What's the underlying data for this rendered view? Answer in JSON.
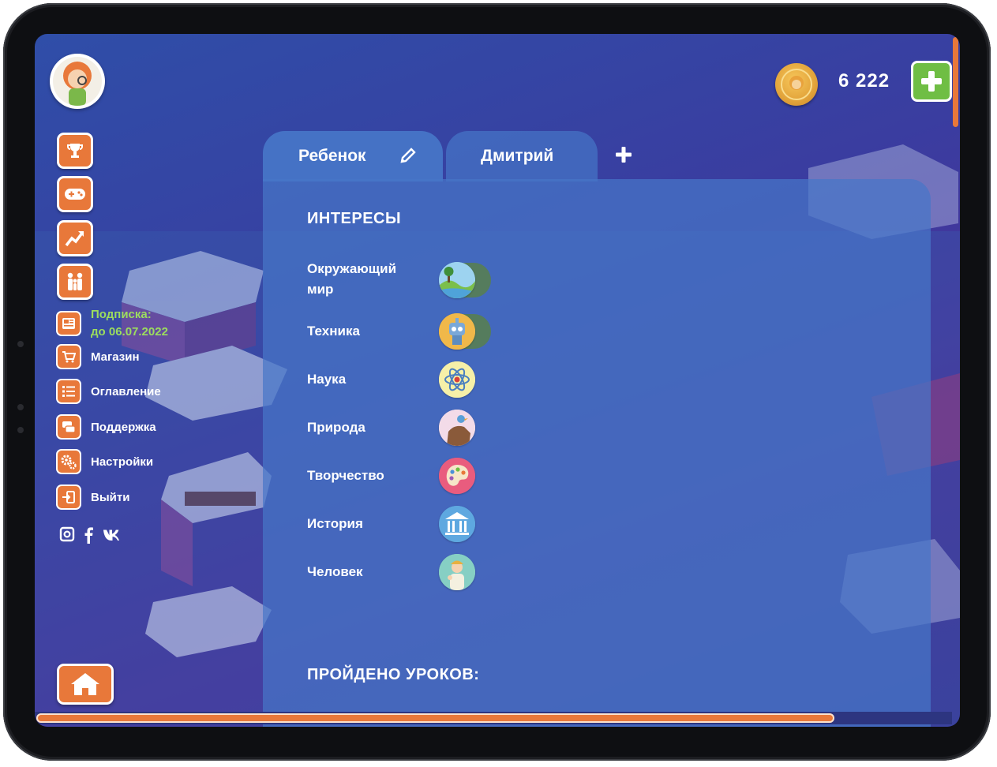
{
  "profile": {
    "avatar_alt": "avatar"
  },
  "nav_icons": [
    {
      "name": "trophy-icon"
    },
    {
      "name": "gamepad-icon"
    },
    {
      "name": "chart-icon"
    },
    {
      "name": "family-icon"
    }
  ],
  "menu": {
    "subscription_label": "Подписка:",
    "subscription_until": "до 06.07.2022",
    "items": [
      {
        "label": "Магазин",
        "icon": "cart-icon"
      },
      {
        "label": "Оглавление",
        "icon": "list-icon"
      },
      {
        "label": "Поддержка",
        "icon": "chat-icon"
      },
      {
        "label": "Настройки",
        "icon": "gears-icon"
      },
      {
        "label": "Выйти",
        "icon": "exit-icon"
      }
    ]
  },
  "social": [
    "instagram-icon",
    "facebook-icon",
    "vk-icon"
  ],
  "header": {
    "coins": "6 222"
  },
  "tabs": [
    {
      "label": "Ребенок",
      "active": true
    },
    {
      "label": "Дмитрий",
      "active": false
    }
  ],
  "interests": {
    "title": "ИНТЕРЕСЫ",
    "items": [
      {
        "label": "Окружающий мир",
        "icon": "landscape-icon",
        "enabled": true
      },
      {
        "label": "Техника",
        "icon": "robot-icon",
        "enabled": true
      },
      {
        "label": "Наука",
        "icon": "atom-icon",
        "enabled": false
      },
      {
        "label": "Природа",
        "icon": "bird-dog-icon",
        "enabled": false
      },
      {
        "label": "Творчество",
        "icon": "palette-icon",
        "enabled": false
      },
      {
        "label": "История",
        "icon": "museum-icon",
        "enabled": false
      },
      {
        "label": "Человек",
        "icon": "person-icon",
        "enabled": false
      }
    ]
  },
  "lessons": {
    "title": "ПРОЙДЕНО УРОКОВ:"
  },
  "progress": {
    "fraction": 0.87
  },
  "colors": {
    "accent": "#e8783a",
    "green": "#6fbe44",
    "subscription": "#9cdd5e",
    "panel": "#4676c8"
  }
}
